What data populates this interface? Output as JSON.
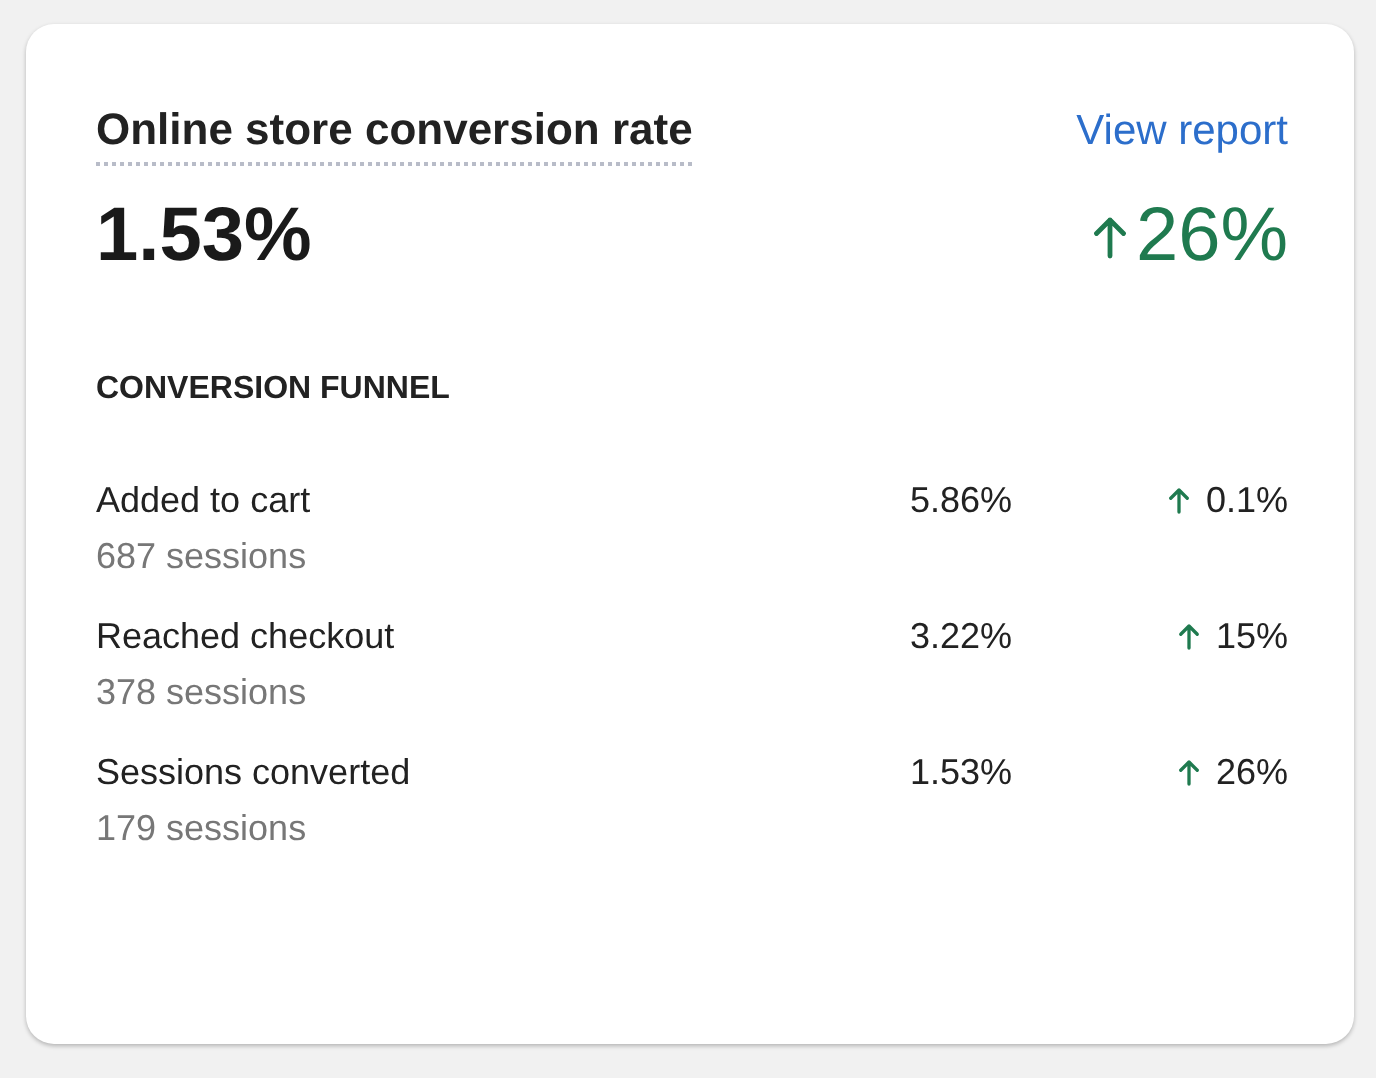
{
  "card": {
    "title": "Online store conversion rate",
    "link": "View report",
    "value": "1.53%",
    "change": {
      "kind": "up",
      "text": "26%"
    }
  },
  "funnel": {
    "heading": "CONVERSION FUNNEL",
    "rows": [
      {
        "label": "Added to cart",
        "sessions": "687 sessions",
        "rate": "5.86%",
        "change": {
          "kind": "up",
          "text": "0.1%"
        }
      },
      {
        "label": "Reached checkout",
        "sessions": "378 sessions",
        "rate": "3.22%",
        "change": {
          "kind": "up",
          "text": "15%"
        }
      },
      {
        "label": "Sessions converted",
        "sessions": "179 sessions",
        "rate": "1.53%",
        "change": {
          "kind": "up",
          "text": "26%"
        }
      }
    ]
  }
}
